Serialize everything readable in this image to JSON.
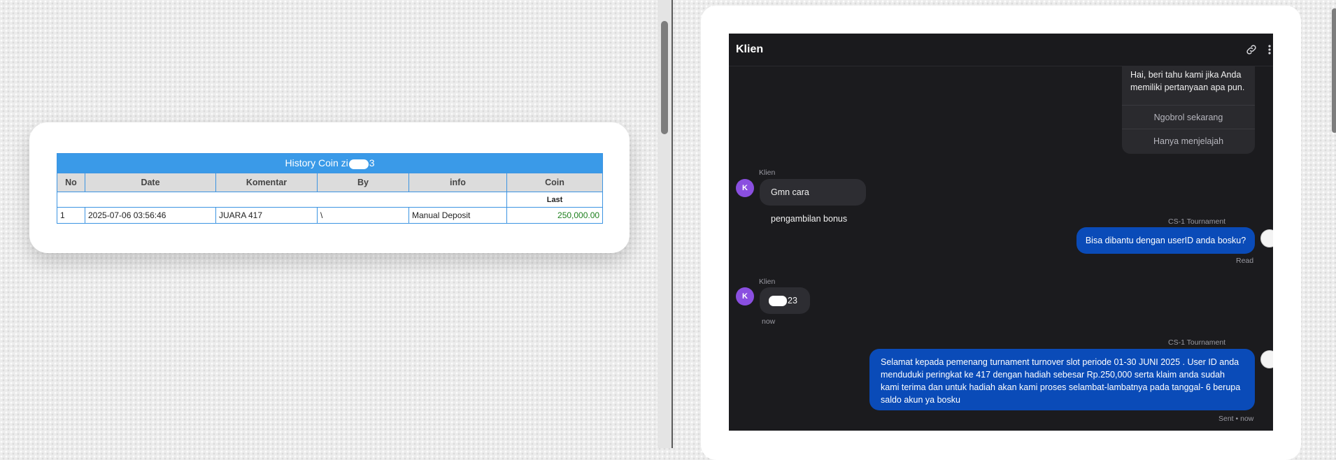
{
  "history_table": {
    "title_prefix": "History Coin zi",
    "title_suffix": "3",
    "columns": [
      "No",
      "Date",
      "Komentar",
      "By",
      "info",
      "Coin"
    ],
    "last_label": "Last",
    "rows": [
      {
        "no": "1",
        "date": "2025-07-06 03:56:46",
        "komentar": "JUARA 417",
        "by": "\\",
        "info": "Manual Deposit",
        "coin": "250,000.00"
      }
    ]
  },
  "chat": {
    "title": "Klien",
    "welcome": {
      "text": "Hai, beri tahu kami jika Anda memiliki pertanyaan apa pun.",
      "buttons": [
        "Ngobrol sekarang",
        "Hanya menjelajah"
      ]
    },
    "messages": [
      {
        "direction": "in",
        "sender": "Klien",
        "avatar_letter": "K",
        "text": "Gmn cara pengambilan bonus"
      },
      {
        "direction": "out",
        "sender": "CS-1 Tournament",
        "text": "Bisa dibantu dengan userID anda bosku?",
        "status": "Read"
      },
      {
        "direction": "in",
        "sender": "Klien",
        "avatar_letter": "K",
        "text_suffix": "23",
        "time": "now"
      },
      {
        "direction": "out",
        "sender": "CS-1 Tournament",
        "text": "Selamat kepada pemenang turnament turnover slot periode 01-30 JUNI 2025 . User ID anda menduduki peringkat ke 417 dengan hadiah sebesar Rp.250,000 serta klaim anda sudah kami terima dan untuk hadiah akan kami proses selambat-lambatnya pada tanggal- 6 berupa saldo akun ya bosku",
        "status": "Sent • now"
      }
    ]
  },
  "icons": {
    "link": "link-icon",
    "more": "more-vertical-icon"
  },
  "colors": {
    "table_header": "#3a9ae8",
    "chat_bg": "#1b1b1e",
    "outgoing_bubble": "#0a4bb8",
    "avatar": "#8a4fe0",
    "coin_green": "#1c7f1c"
  }
}
